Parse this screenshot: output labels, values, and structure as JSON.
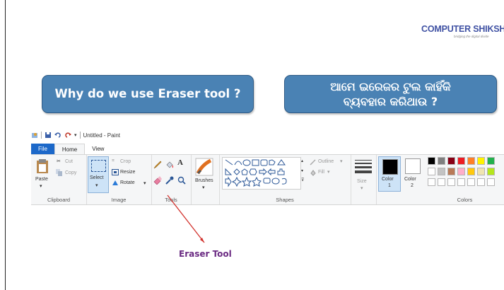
{
  "logo": {
    "part1": "COMPUTER",
    "part2": " SHIKSHA",
    "tagline": "bridging the digital divide"
  },
  "bubbles": {
    "english": "Why do we use Eraser tool ?",
    "odia": "ଆମେ ଇରେଜର ଟୁଲ କାହିଁକି\nବ୍ୟବହାର କରିଥାଉ ?"
  },
  "paint": {
    "title": "Untitled - Paint",
    "tabs": {
      "file": "File",
      "home": "Home",
      "view": "View"
    },
    "clipboard": {
      "paste": "Paste",
      "cut": "Cut",
      "copy": "Copy",
      "label": "Clipboard"
    },
    "image": {
      "select": "Select",
      "crop": "Crop",
      "resize": "Resize",
      "rotate": "Rotate",
      "label": "Image"
    },
    "tools": {
      "label": "Tools",
      "text_tool": "A"
    },
    "brushes": {
      "label": "Brushes"
    },
    "shapes": {
      "outline": "Outline",
      "fill": "Fill",
      "label": "Shapes"
    },
    "size": {
      "label": "Size"
    },
    "color1": {
      "label": "Color",
      "num": "1"
    },
    "color2": {
      "label": "Color",
      "num": "2"
    },
    "colors": {
      "label": "Colors",
      "row1": [
        "#000000",
        "#7f7f7f",
        "#880015",
        "#ed1c24",
        "#ff7f27",
        "#fff200",
        "#22b14c"
      ],
      "row2": [
        "#ffffff",
        "#c3c3c3",
        "#b97a57",
        "#ffaec9",
        "#ffc90e",
        "#efe4b0",
        "#b5e61d"
      ]
    }
  },
  "annotation": {
    "label": "Eraser Tool"
  }
}
